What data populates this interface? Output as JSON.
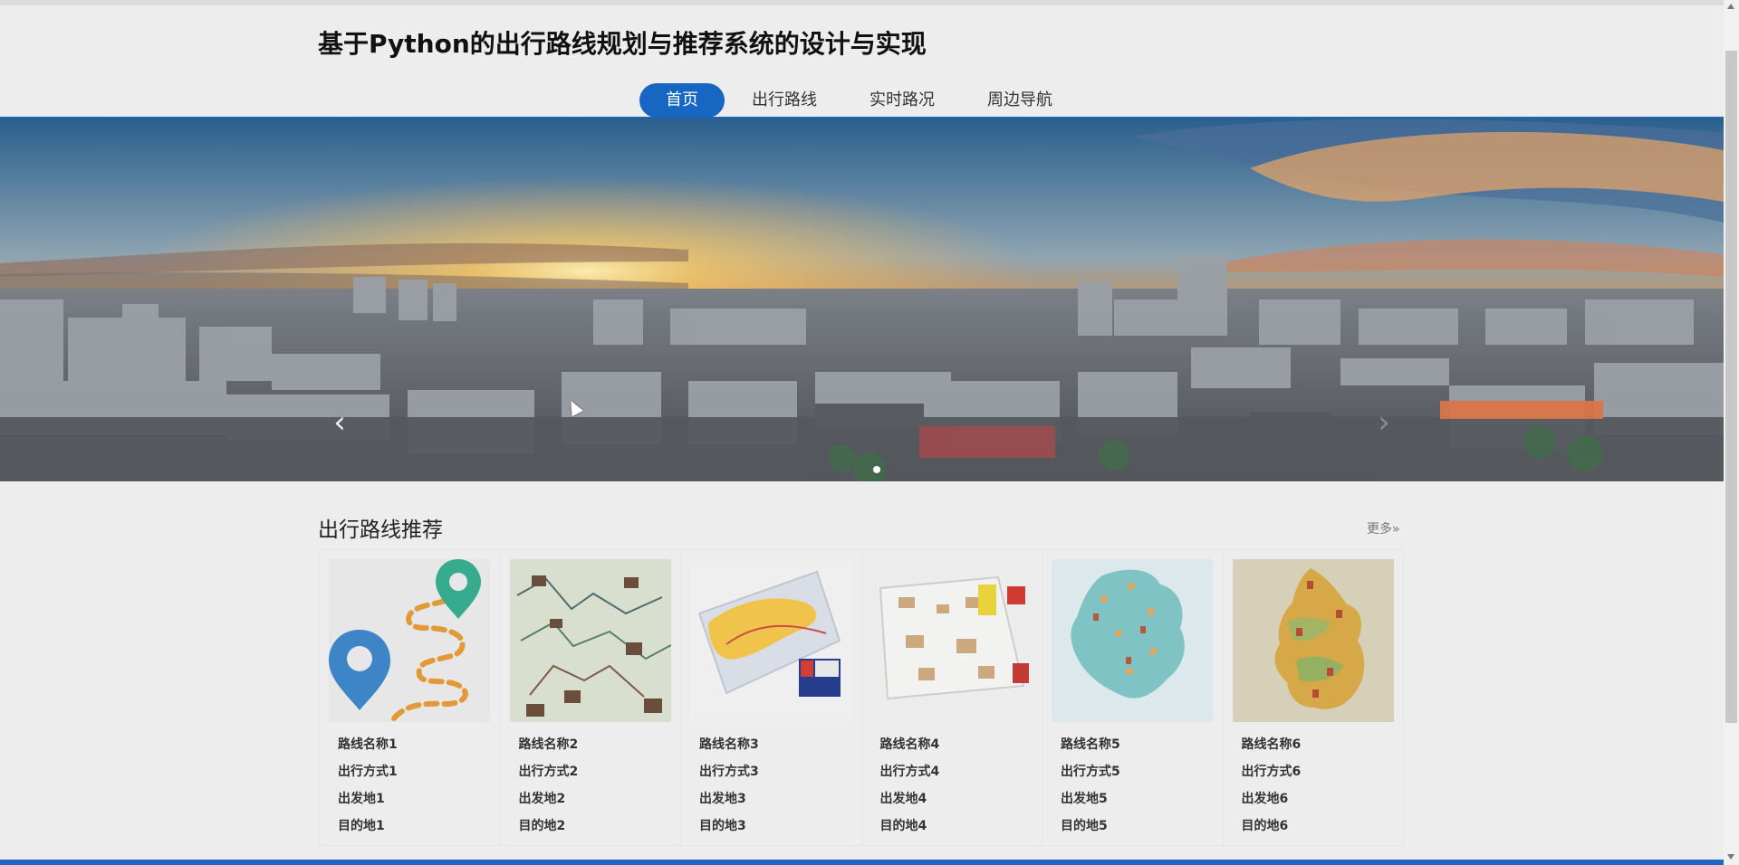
{
  "header": {
    "title": "基于Python的出行路线规划与推荐系统的设计与实现"
  },
  "nav": {
    "items": [
      {
        "label": "首页",
        "active": true
      },
      {
        "label": "出行路线",
        "active": false
      },
      {
        "label": "实时路况",
        "active": false
      },
      {
        "label": "周边导航",
        "active": false
      }
    ]
  },
  "banner": {
    "left_arrow": "‹",
    "right_arrow": "›"
  },
  "section": {
    "title": "出行路线推荐",
    "more_label": "更多»"
  },
  "cards": [
    {
      "name": "路线名称1",
      "mode": "出行方式1",
      "from": "出发地1",
      "to": "目的地1"
    },
    {
      "name": "路线名称2",
      "mode": "出行方式2",
      "from": "出发地2",
      "to": "目的地2"
    },
    {
      "name": "路线名称3",
      "mode": "出行方式3",
      "from": "出发地3",
      "to": "目的地3"
    },
    {
      "name": "路线名称4",
      "mode": "出行方式4",
      "from": "出发地4",
      "to": "目的地4"
    },
    {
      "name": "路线名称5",
      "mode": "出行方式5",
      "from": "出发地5",
      "to": "目的地5"
    },
    {
      "name": "路线名称6",
      "mode": "出行方式6",
      "from": "出发地6",
      "to": "目的地6"
    }
  ],
  "colors": {
    "accent": "#1666c2",
    "bottom_bar": "#1e67c2"
  }
}
